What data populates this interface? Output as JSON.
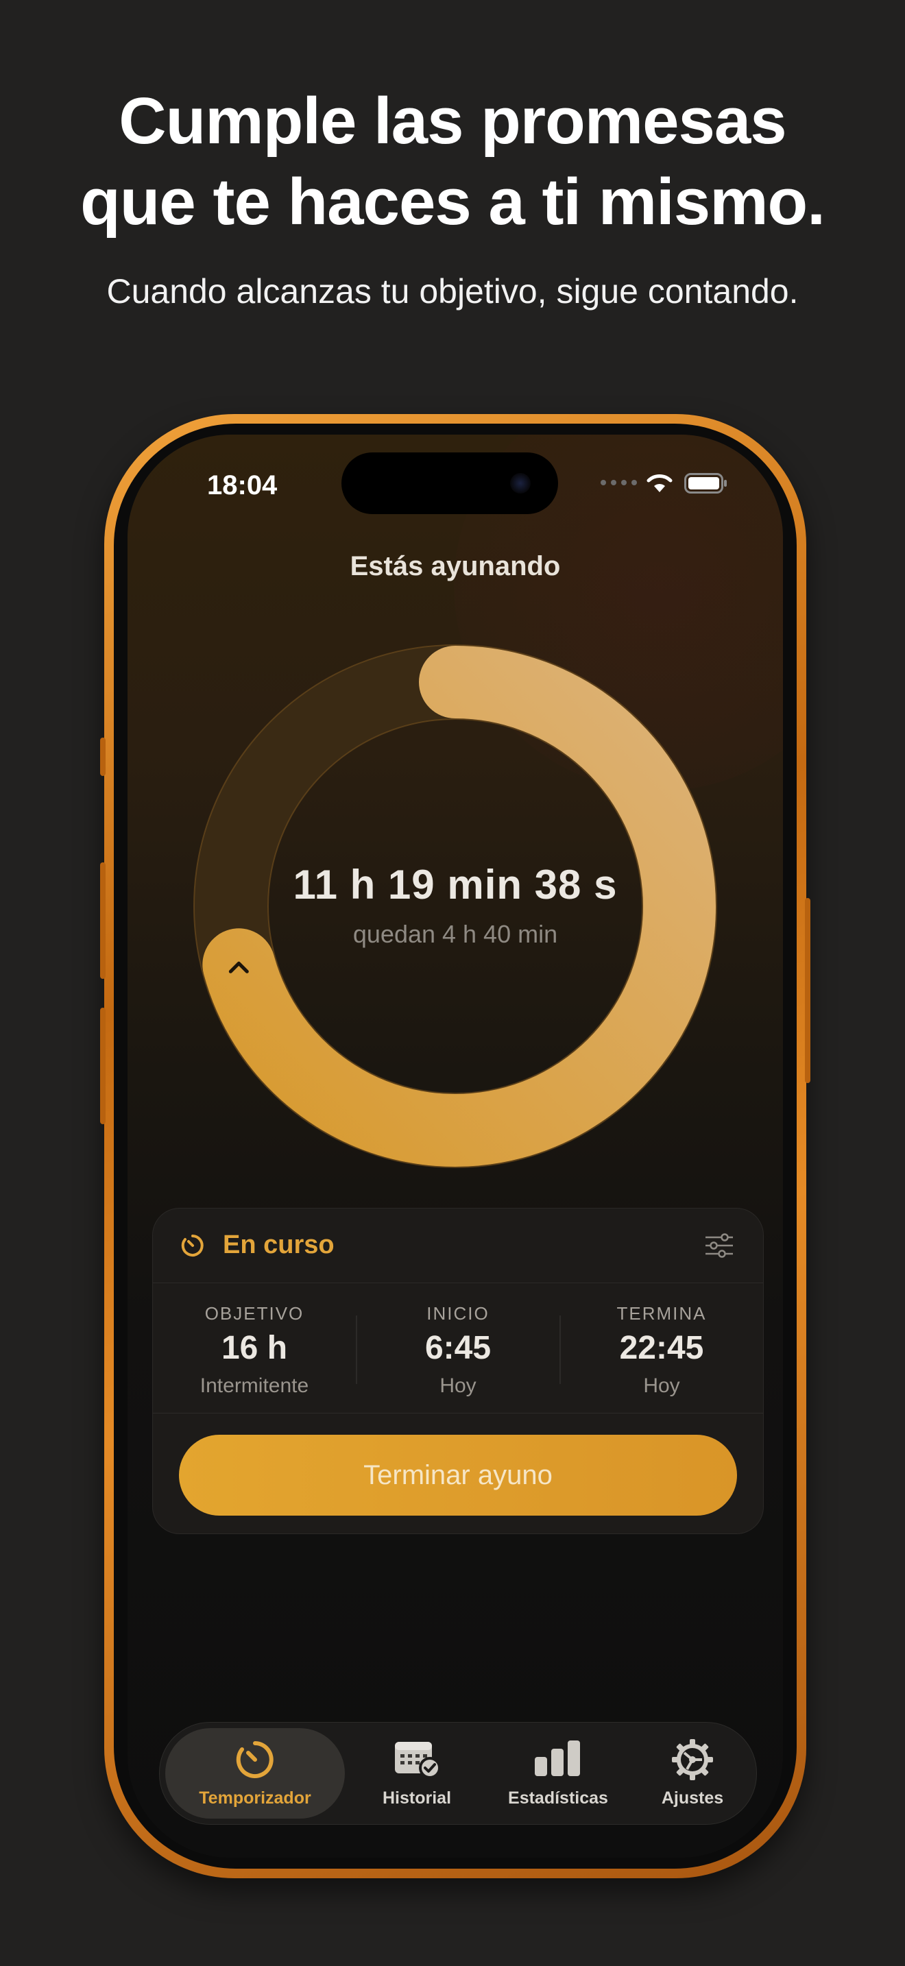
{
  "promo": {
    "title_line1": "Cumple las promesas",
    "title_line2": "que te haces a ti mismo.",
    "subtitle": "Cuando alcanzas tu objetivo, sigue contando."
  },
  "status_bar": {
    "time": "18:04"
  },
  "screen": {
    "title": "Estás ayunando"
  },
  "timer": {
    "elapsed": "11 h 19 min 38 s",
    "remaining": "quedan 4 h 40 min",
    "progress_fraction": 0.708
  },
  "fast_card": {
    "status_label": "En curso",
    "stats": [
      {
        "label": "OBJETIVO",
        "value": "16 h",
        "note": "Intermitente"
      },
      {
        "label": "INICIO",
        "value": "6:45",
        "note": "Hoy"
      },
      {
        "label": "TERMINA",
        "value": "22:45",
        "note": "Hoy"
      }
    ],
    "end_button_label": "Terminar ayuno"
  },
  "tab_bar": {
    "tabs": [
      {
        "label": "Temporizador",
        "icon": "timer-icon",
        "active": true
      },
      {
        "label": "Historial",
        "icon": "calendar-check-icon",
        "active": false
      },
      {
        "label": "Estadísticas",
        "icon": "bar-chart-icon",
        "active": false
      },
      {
        "label": "Ajustes",
        "icon": "gear-icon",
        "active": false
      }
    ]
  },
  "colors": {
    "accent": "#E3A53A",
    "ring_track": "#3A2A14",
    "ring_fill_start": "#D89A2E",
    "ring_fill_end": "#DDB277",
    "background": "#222120",
    "phone_frame": "#E58B26"
  }
}
